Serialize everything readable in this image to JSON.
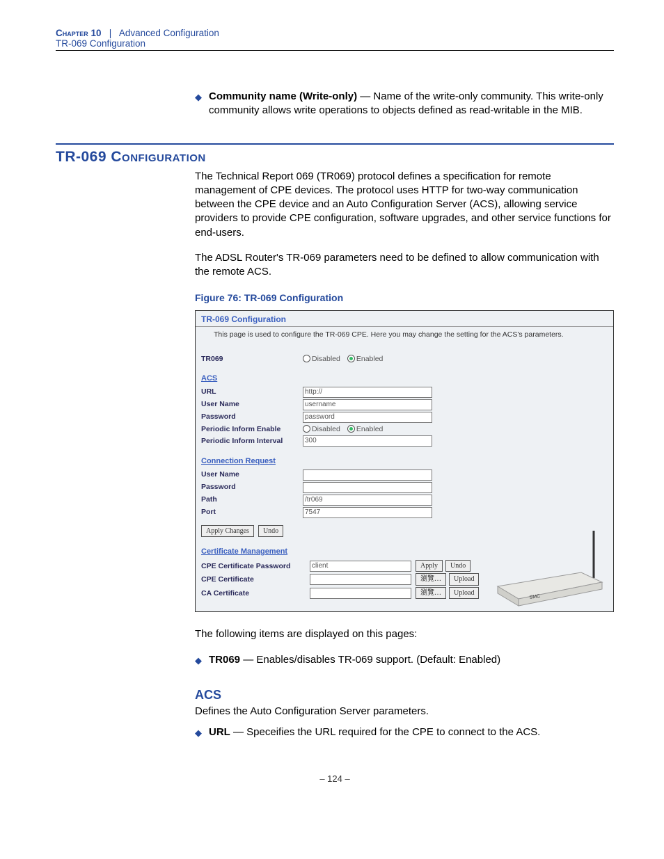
{
  "header": {
    "chapter": "Chapter 10",
    "separator": "|",
    "title": "Advanced Configuration",
    "subtitle": "TR-069 Configuration"
  },
  "top_bullet": {
    "term": "Community name (Write-only)",
    "dash": " — ",
    "desc": "Name of the write-only community. This write-only community allows write operations to objects defined as read-writable in the MIB."
  },
  "section_title": "TR-069 Configuration",
  "para1": "The Technical Report 069 (TR069) protocol defines a specification for remote management of CPE devices. The protocol uses HTTP for two-way communication between the CPE device and an Auto Configuration Server (ACS), allowing service providers to provide CPE configuration, software upgrades, and other service functions for end-users.",
  "para2": "The ADSL Router's TR-069 parameters need to be defined to allow communication with the remote ACS.",
  "figure_caption": "Figure 76:  TR-069 Configuration",
  "screenshot": {
    "title": "TR-069 Configuration",
    "desc": "This page is used to configure the TR-069 CPE. Here you may change the setting for the ACS's parameters.",
    "tr069_label": "TR069",
    "disabled": "Disabled",
    "enabled": "Enabled",
    "acs_head": "ACS",
    "url_label": "URL",
    "url_value": "http://",
    "user_label": "User Name",
    "user_value": "username",
    "pass_label": "Password",
    "pass_value": "password",
    "pie_label": "Periodic Inform Enable",
    "pii_label": "Periodic Inform Interval",
    "pii_value": "300",
    "cr_head": "Connection Request",
    "cr_user_label": "User Name",
    "cr_pass_label": "Password",
    "cr_path_label": "Path",
    "cr_path_value": "/tr069",
    "cr_port_label": "Port",
    "cr_port_value": "7547",
    "apply_changes": "Apply Changes",
    "undo": "Undo",
    "cert_head": "Certificate Management",
    "cpe_pass_label": "CPE Certificate Password",
    "cpe_pass_value": "client",
    "cpe_cert_label": "CPE Certificate",
    "ca_cert_label": "CA Certificate",
    "apply": "Apply",
    "browse": "瀏覽…",
    "upload": "Upload"
  },
  "items_intro": "The following items are displayed on this pages:",
  "item1_term": "TR069",
  "item1_desc": " — Enables/disables TR-069 support. (Default: Enabled)",
  "acs_heading": "ACS",
  "acs_para": "Defines the Auto Configuration Server parameters.",
  "item2_term": "URL",
  "item2_desc": " — Speceifies the URL required for the CPE to connect to the ACS.",
  "page_number": "–  124  –"
}
